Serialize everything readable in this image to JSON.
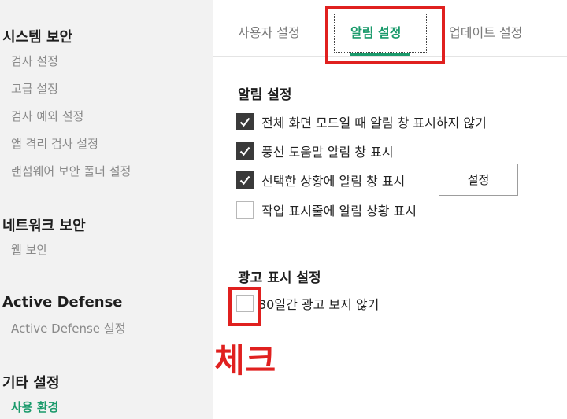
{
  "sidebar": {
    "groups": [
      {
        "title": "시스템 보안",
        "items": [
          "검사 설정",
          "고급 설정",
          "검사 예외 설정",
          "앱 격리 검사 설정",
          "랜섬웨어 보안 폴더 설정"
        ]
      },
      {
        "title": "네트워크 보안",
        "items": [
          "웹 보안"
        ]
      },
      {
        "title": "Active Defense",
        "items": [
          "Active Defense 설정"
        ]
      },
      {
        "title": "기타 설정",
        "items": [
          "사용 환경"
        ]
      }
    ],
    "active_item": "사용 환경"
  },
  "tabs": [
    {
      "label": "사용자 설정",
      "active": false
    },
    {
      "label": "알림 설정",
      "active": true
    },
    {
      "label": "업데이트 설정",
      "active": false
    }
  ],
  "notification_section": {
    "title": "알림 설정",
    "options": [
      {
        "label": "전체 화면 모드일 때 알림 창 표시하지 않기",
        "checked": true
      },
      {
        "label": "풍선 도움말 알림 창 표시",
        "checked": true
      },
      {
        "label": "선택한 상황에 알림 창 표시",
        "checked": true
      },
      {
        "label": "작업 표시줄에 알림 상황 표시",
        "checked": false
      }
    ],
    "settings_button": "설정"
  },
  "ad_section": {
    "title": "광고 표시 설정",
    "options": [
      {
        "label": "30일간 광고 보지 않기",
        "checked": false
      }
    ]
  },
  "annotation": {
    "text": "체크",
    "color": "#e0201f"
  },
  "colors": {
    "accent": "#1a9a6b",
    "annotation_red": "#e0201f",
    "sidebar_bg": "#f2f2f2"
  }
}
